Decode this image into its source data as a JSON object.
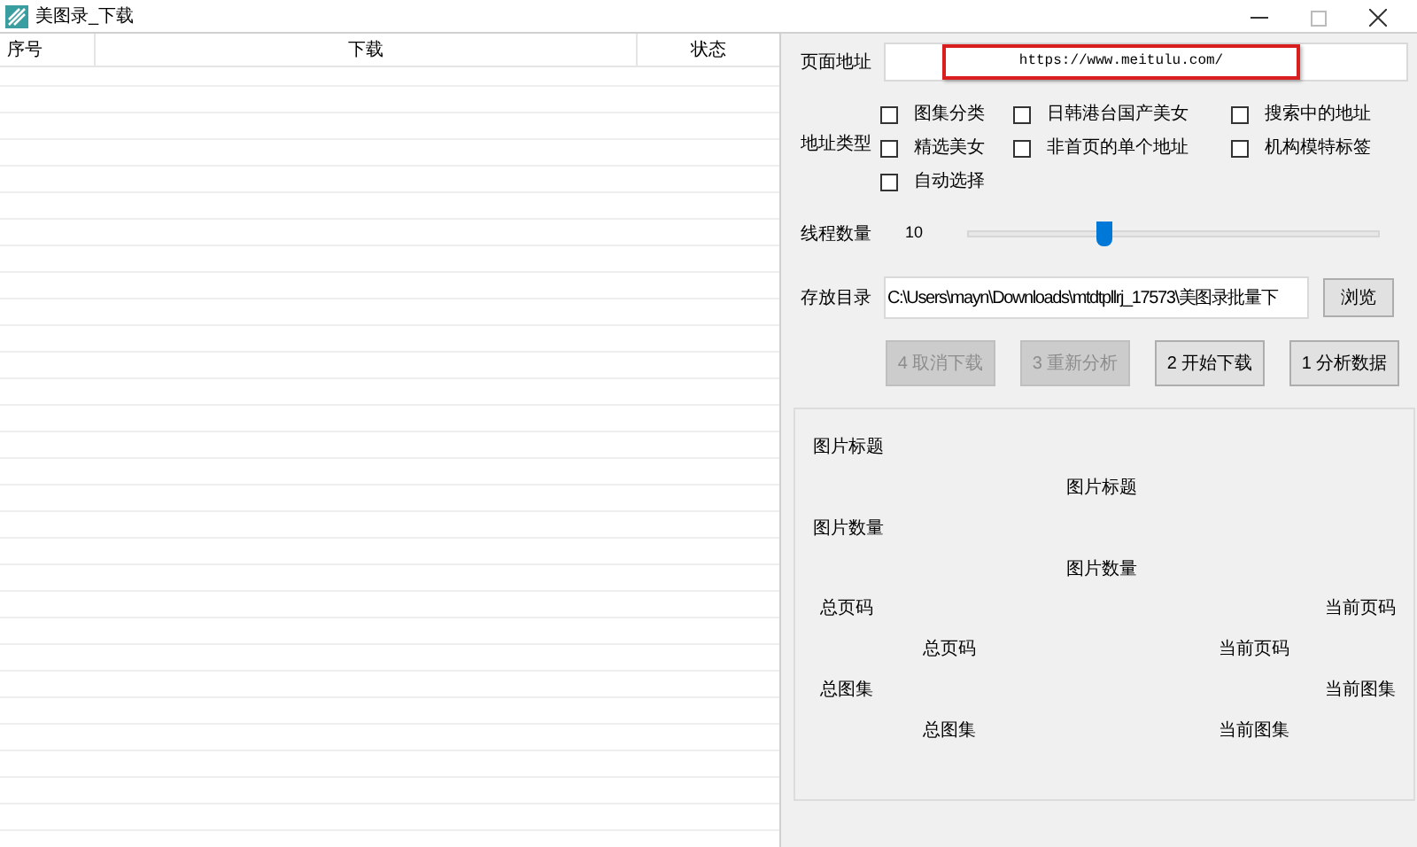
{
  "window": {
    "title": "美图录_下载"
  },
  "table": {
    "columns": [
      "序号",
      "下载",
      "状态"
    ]
  },
  "form": {
    "url_label": "页面地址",
    "url": "https://www.meitulu.com/",
    "url_highlighted": true,
    "type_label": "地址类型",
    "types": [
      {
        "label": "图集分类",
        "checked": false
      },
      {
        "label": "日韩港台国产美女",
        "checked": false
      },
      {
        "label": "搜索中的地址",
        "checked": false
      },
      {
        "label": "精选美女",
        "checked": false
      },
      {
        "label": "非首页的单个地址",
        "checked": false
      },
      {
        "label": "机构模特标签",
        "checked": false
      },
      {
        "label": "自动选择",
        "checked": false
      }
    ],
    "threads_label": "线程数量",
    "threads": "10",
    "threads_slider": {
      "level": 0.32
    },
    "dir_label": "存放目录",
    "dir": "C:\\Users\\mayn\\Downloads\\mtdtpllrj_17573\\美图录批量下",
    "browse": "浏览",
    "buttons": [
      {
        "label": "4 取消下载",
        "disabled": true
      },
      {
        "label": "3 重新分析",
        "disabled": true
      },
      {
        "label": "2 开始下载",
        "disabled": false
      },
      {
        "label": "1 分析数据",
        "disabled": false
      }
    ]
  },
  "info": {
    "title_label": "图片标题",
    "title_value": "图片标题",
    "count_label": "图片数量",
    "count_value": "图片数量",
    "total_pages_label": "总页码",
    "current_page_label": "当前页码",
    "total_pages_value": "总页码",
    "current_page_value": "当前页码",
    "total_sets_label": "总图集",
    "current_set_label": "当前图集",
    "total_sets_value": "总图集",
    "current_set_value": "当前图集"
  }
}
